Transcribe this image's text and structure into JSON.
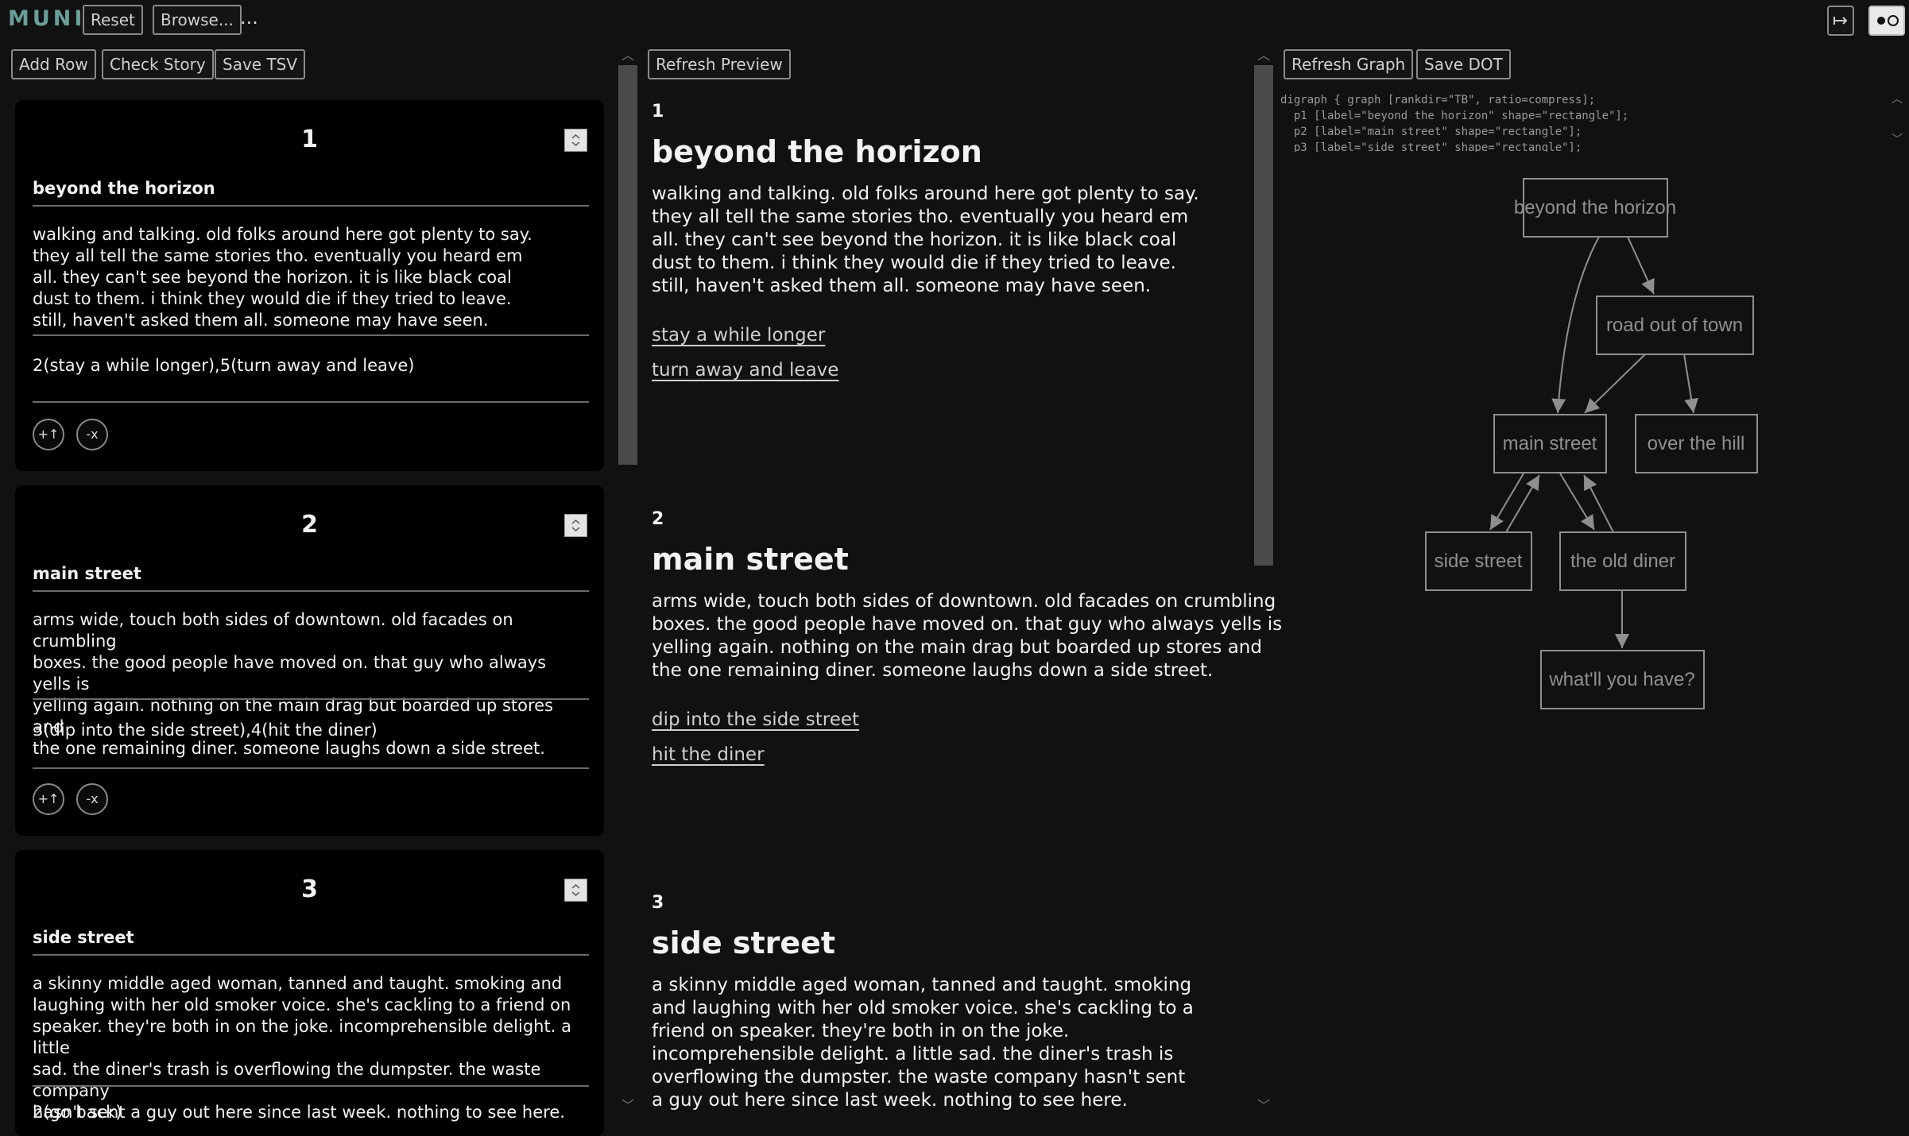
{
  "app": {
    "logo": "MUNI",
    "ellipsis": "..."
  },
  "toolbar": {
    "reset": "Reset",
    "browse": "Browse..."
  },
  "editor": {
    "add_row": "Add Row",
    "check_story": "Check Story",
    "save_tsv": "Save TSV",
    "rows": [
      {
        "num": "1",
        "title": "beyond the horizon",
        "body": "walking and talking. old folks around here got plenty to say.\nthey all tell the same stories tho. eventually you heard em\nall. they can't see beyond the horizon. it is like black coal\ndust to them. i think they would die if they tried to leave.\nstill, haven't asked them all. someone may have seen.",
        "links": "2(stay a while longer),5(turn away and leave)",
        "insert": "+↑",
        "delete": "-x"
      },
      {
        "num": "2",
        "title": "main street",
        "body": "arms wide, touch both sides of downtown. old facades on crumbling\nboxes. the good people have moved on. that guy who always yells is\nyelling again. nothing on the main drag but boarded up stores and\nthe one remaining diner. someone laughs down a side street.",
        "links": "3(dip into the side street),4(hit the diner)",
        "insert": "+↑",
        "delete": "-x"
      },
      {
        "num": "3",
        "title": "side street",
        "body": "a skinny middle aged woman, tanned and taught. smoking and\nlaughing with her old smoker voice. she's cackling to a friend on\nspeaker. they're both in on the joke. incomprehensible delight. a little\nsad. the diner's trash is overflowing the dumpster. the waste company\nhasn't sent a guy out here since last week. nothing to see here.",
        "links": "2(go back)"
      }
    ]
  },
  "preview": {
    "refresh": "Refresh Preview",
    "passages": [
      {
        "num": "1",
        "title": "beyond the horizon",
        "body": "walking and talking. old folks around here got plenty to say.\nthey all tell the same stories tho. eventually you heard em\nall. they can't see beyond the horizon. it is like black coal\ndust to them. i think they would die if they tried to leave.\nstill, haven't asked them all. someone may have seen.",
        "choices": [
          "stay a while longer",
          "turn away and leave"
        ]
      },
      {
        "num": "2",
        "title": "main street",
        "body": "arms wide, touch both sides of downtown. old facades on crumbling\nboxes. the good people have moved on. that guy who always yells is\nyelling again. nothing on the main drag but boarded up stores and\nthe one remaining diner. someone laughs down a side street.",
        "choices": [
          "dip into the side street",
          "hit the diner"
        ]
      },
      {
        "num": "3",
        "title": "side street",
        "body": "a skinny middle aged woman, tanned and taught. smoking\nand laughing with her old smoker voice. she's cackling to a\nfriend on speaker. they're both in on the joke.\nincomprehensible delight. a little sad. the diner's trash is\noverflowing the dumpster. the waste company hasn't sent\na guy out here since last week. nothing to see here.",
        "choices": []
      }
    ]
  },
  "graph": {
    "refresh": "Refresh Graph",
    "save_dot": "Save DOT",
    "dot_source": "digraph { graph [rankdir=\"TB\", ratio=compress];\n  p1 [label=\"beyond the horizon\" shape=\"rectangle\"];\n  p2 [label=\"main street\" shape=\"rectangle\"];\n  p3 [label=\"side street\" shape=\"rectangle\"];",
    "nodes": [
      "beyond the horizon",
      "road out of town",
      "main street",
      "over the hill",
      "side street",
      "the old diner",
      "what'll you have?"
    ]
  },
  "icons": {
    "expand": "expand-icon",
    "toggle": "theme-toggle-icon"
  }
}
